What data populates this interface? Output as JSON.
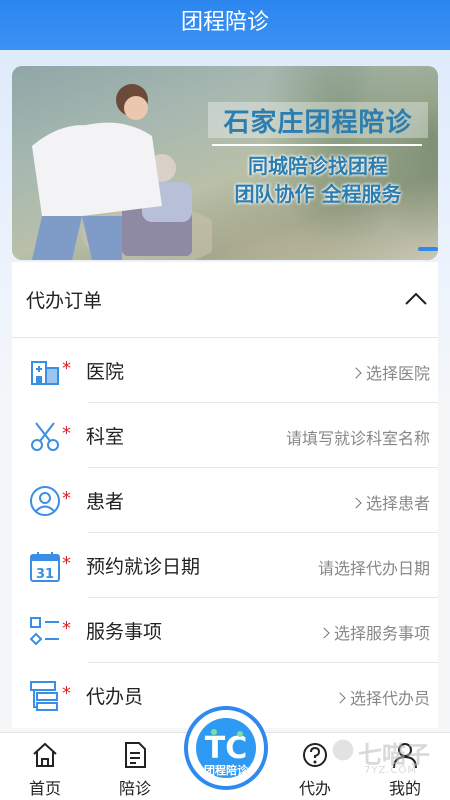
{
  "header": {
    "title": "团程陪诊"
  },
  "banner": {
    "title": "石家庄团程陪诊",
    "line1": "同城陪诊找团程",
    "line2": "团队协作 全程服务"
  },
  "form": {
    "title": "代办订单",
    "rows": [
      {
        "label": "医院",
        "value": "选择医院",
        "chevron": true,
        "icon": "hospital-icon"
      },
      {
        "label": "科室",
        "value": "请填写就诊科室名称",
        "chevron": false,
        "icon": "scissors-icon"
      },
      {
        "label": "患者",
        "value": "选择患者",
        "chevron": true,
        "icon": "user-icon"
      },
      {
        "label": "预约就诊日期",
        "value": "请选择代办日期",
        "chevron": false,
        "icon": "calendar-icon",
        "calendar_day": "31"
      },
      {
        "label": "服务事项",
        "value": "选择服务事项",
        "chevron": true,
        "icon": "list-icon"
      },
      {
        "label": "代办员",
        "value": "选择代办员",
        "chevron": true,
        "icon": "agent-icon"
      }
    ]
  },
  "tabbar": {
    "items": [
      {
        "label": "首页",
        "icon": "home-icon"
      },
      {
        "label": "陪诊",
        "icon": "document-icon"
      },
      {
        "label": "代办",
        "icon": "question-icon"
      },
      {
        "label": "我的",
        "icon": "person-icon"
      }
    ],
    "center": {
      "logo_letters": "TC",
      "caption": "团程陪诊"
    }
  },
  "watermark": {
    "text": "七喵子",
    "url": "7YZ.COM"
  },
  "colors": {
    "primary": "#2f8af0",
    "required_star": "#e0202a",
    "icon_blue": "#3a8ee6"
  }
}
